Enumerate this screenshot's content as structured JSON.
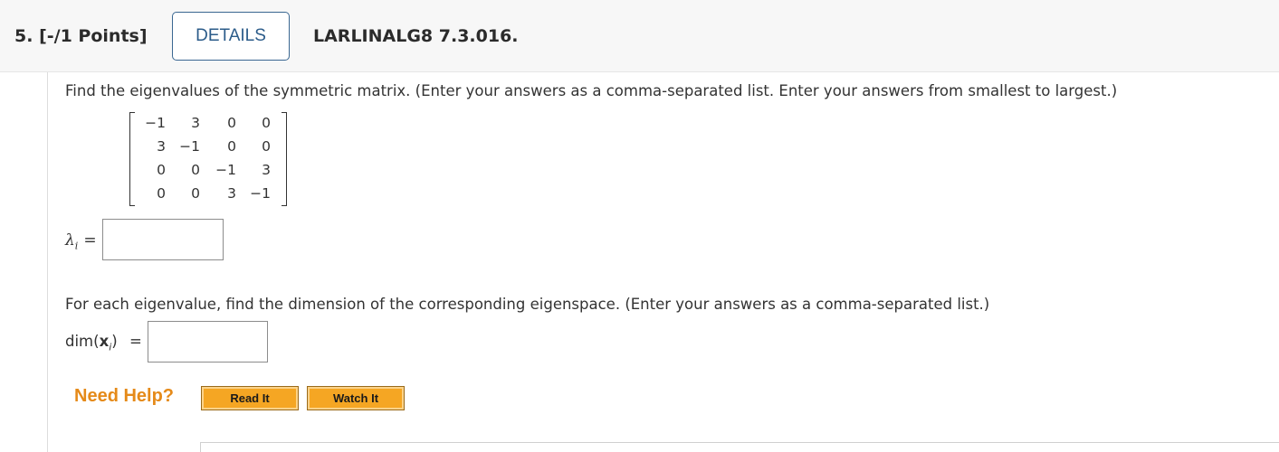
{
  "header": {
    "question_number": "5.",
    "points": "[-/1 Points]",
    "details_label": "DETAILS",
    "problem_code": "LARLINALG8 7.3.016."
  },
  "part1": {
    "prompt": "Find the eigenvalues of the symmetric matrix. (Enter your answers as a comma-separated list. Enter your answers from smallest to largest.)",
    "matrix": [
      [
        "−1",
        "3",
        "0",
        "0"
      ],
      [
        "3",
        "−1",
        "0",
        "0"
      ],
      [
        "0",
        "0",
        "−1",
        "3"
      ],
      [
        "0",
        "0",
        "3",
        "−1"
      ]
    ],
    "answer_label_symbol": "λ",
    "answer_label_sub": "i",
    "equals": "=",
    "answer_value": ""
  },
  "part2": {
    "prompt": "For each eigenvalue, find the dimension of the corresponding eigenspace. (Enter your answers as a comma-separated list.)",
    "label_prefix": "dim(",
    "label_bold": "x",
    "label_sub": "i",
    "label_suffix": ")",
    "equals": "=",
    "answer_value": ""
  },
  "help": {
    "need_help": "Need Help?",
    "read_it": "Read It",
    "watch_it": "Watch It"
  },
  "colors": {
    "details_border": "#3a6791",
    "need_help": "#e58a19",
    "help_button": "#f5a623"
  }
}
